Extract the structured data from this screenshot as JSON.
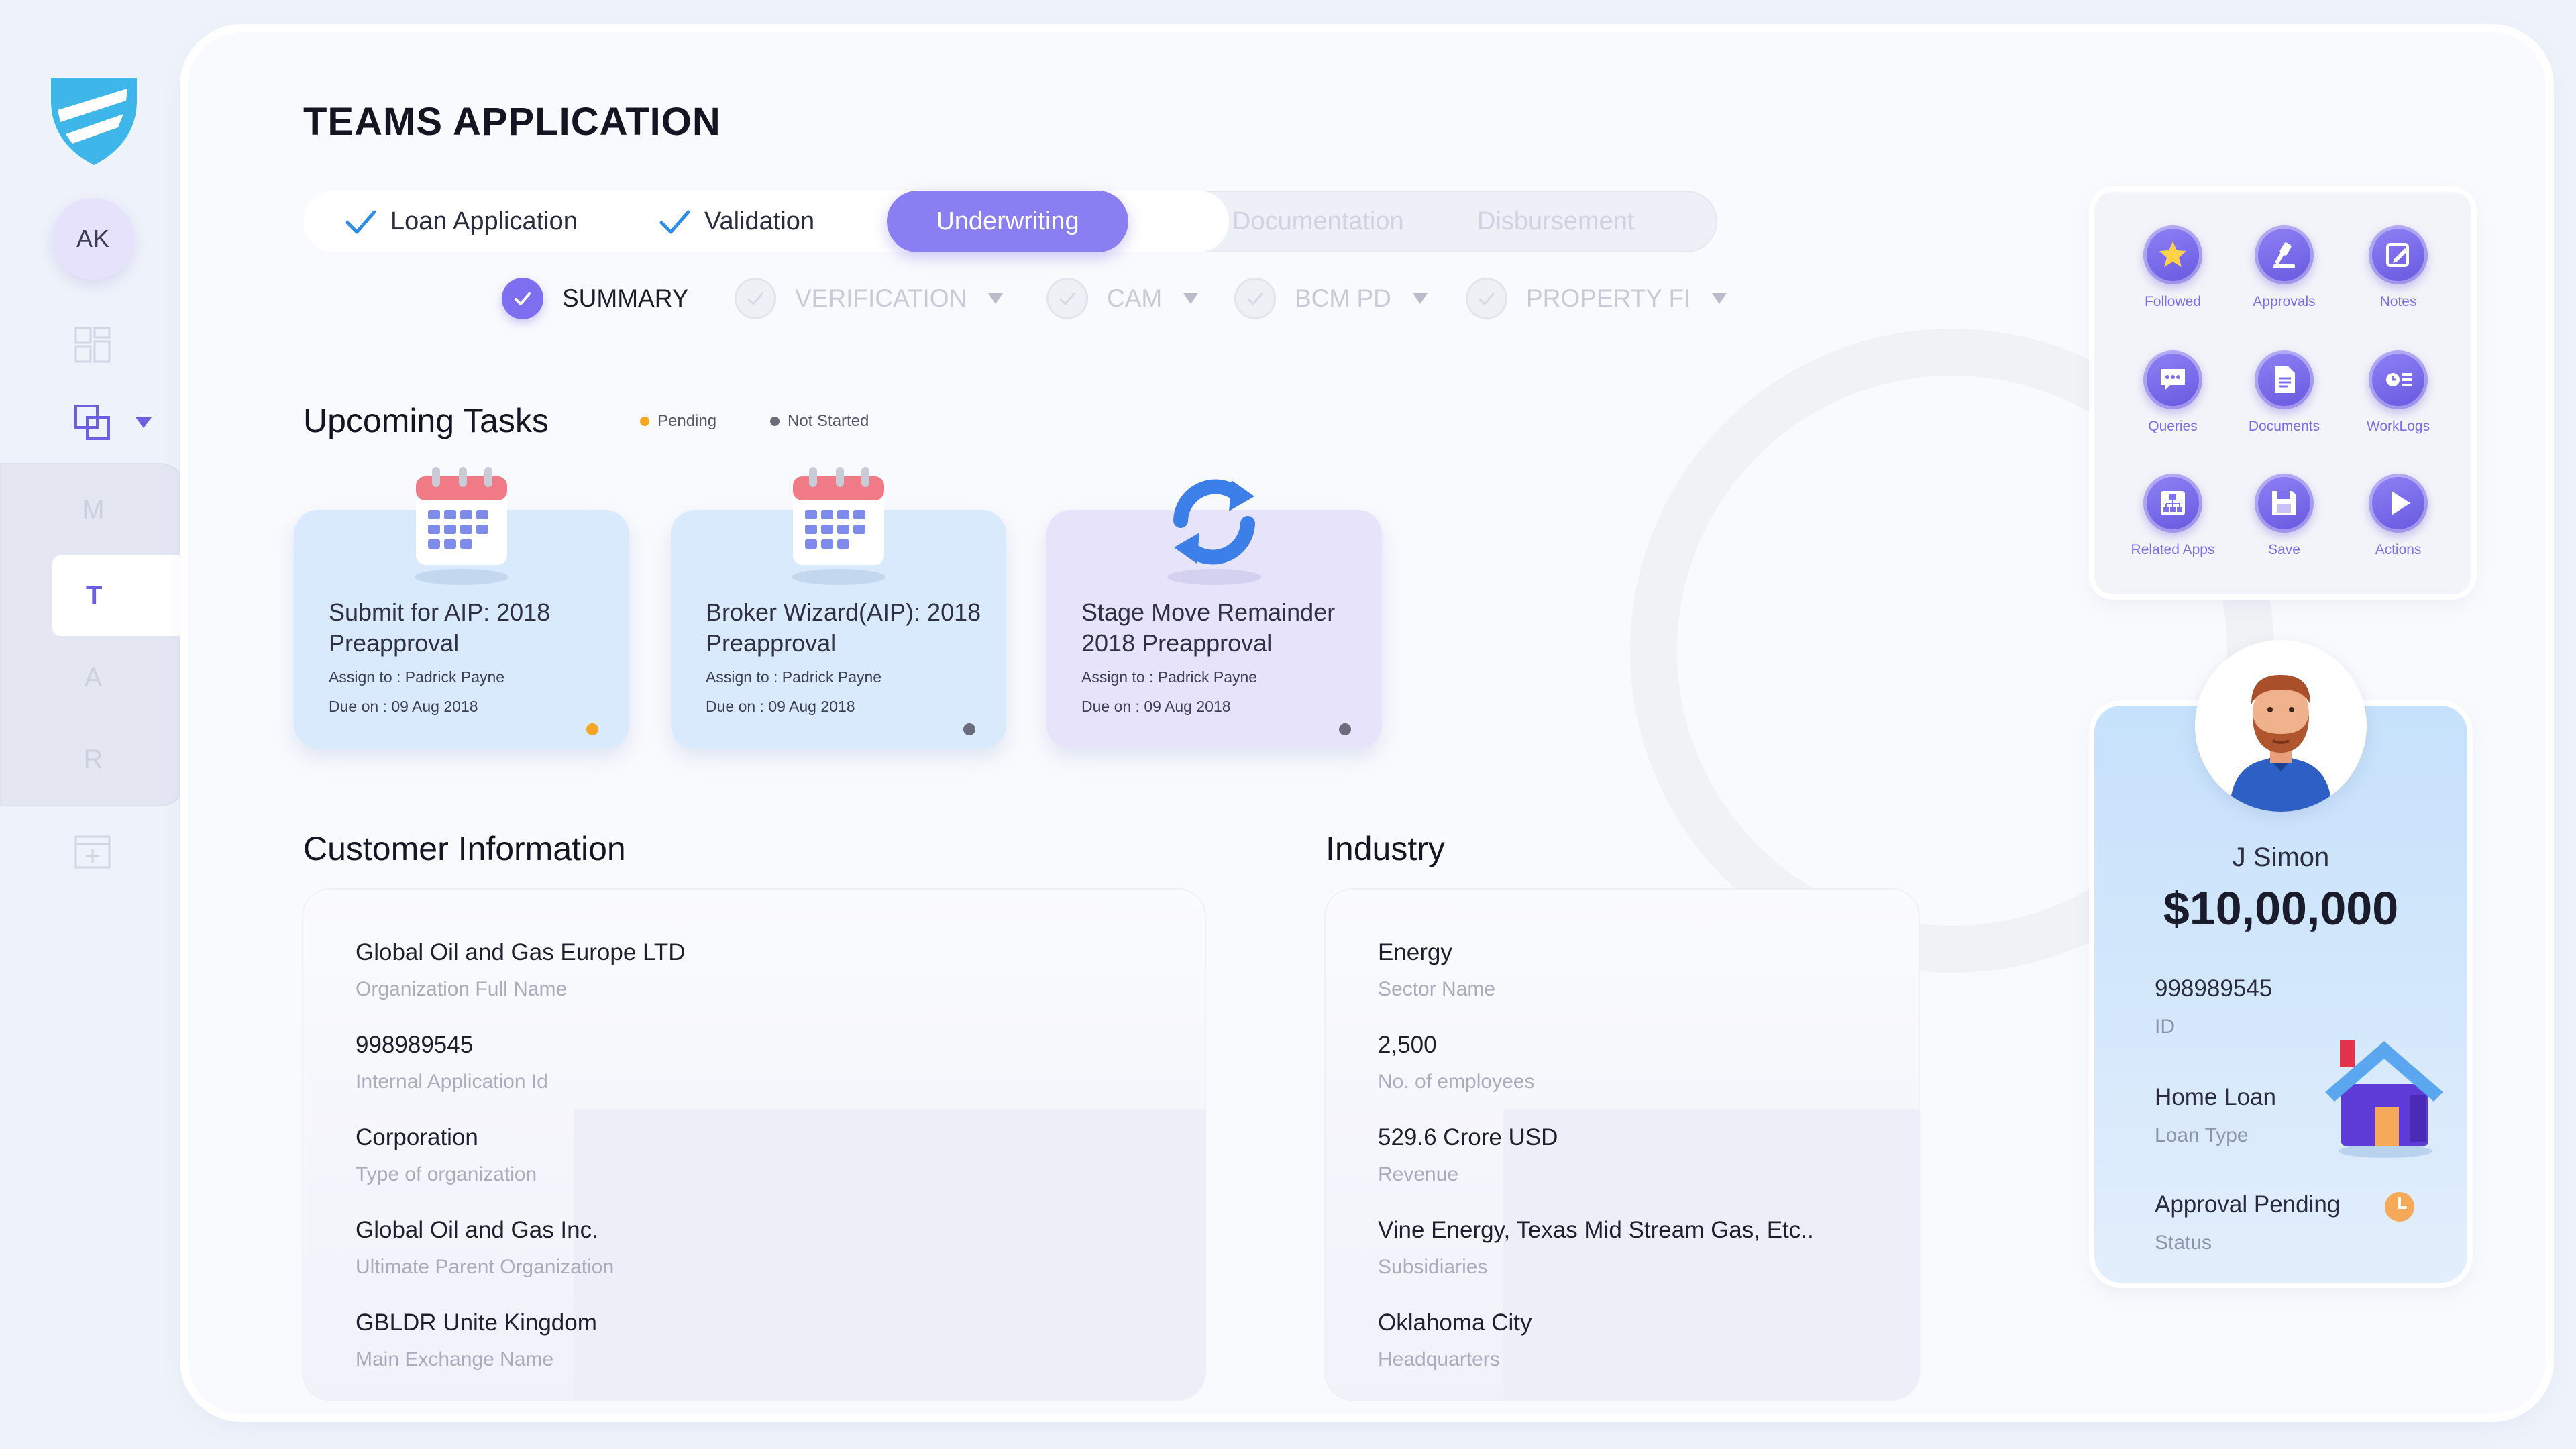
{
  "sidebar": {
    "avatar_initials": "AK",
    "letters": [
      "M",
      "T",
      "A",
      "R"
    ]
  },
  "page": {
    "title": "TEAMS APPLICATION"
  },
  "stepper": {
    "steps": [
      {
        "label": "Loan Application",
        "state": "done"
      },
      {
        "label": "Validation",
        "state": "done"
      },
      {
        "label": "Underwriting",
        "state": "active"
      },
      {
        "label": "Documentation",
        "state": "pending"
      },
      {
        "label": "Disbursement",
        "state": "pending"
      }
    ]
  },
  "substeps": [
    {
      "label": "SUMMARY",
      "active": true
    },
    {
      "label": "VERIFICATION",
      "active": false
    },
    {
      "label": "CAM",
      "active": false
    },
    {
      "label": "BCM PD",
      "active": false
    },
    {
      "label": "PROPERTY FI",
      "active": false
    }
  ],
  "upcoming": {
    "title": "Upcoming Tasks",
    "legend": [
      {
        "label": "Pending",
        "color": "#f6a623"
      },
      {
        "label": "Not Started",
        "color": "#6b6d7c"
      }
    ],
    "tasks": [
      {
        "icon": "calendar-icon",
        "name": "Submit for AIP: 2018 Preapproval",
        "assign": "Assign to : Padrick Payne",
        "due": "Due on : 09 Aug 2018",
        "status_color": "#f6a623"
      },
      {
        "icon": "calendar-icon",
        "name": "Broker Wizard(AIP): 2018 Preapproval",
        "assign": "Assign to : Padrick Payne",
        "due": "Due on : 09 Aug 2018",
        "status_color": "#6b6d7c"
      },
      {
        "icon": "refresh-icon",
        "name": "Stage Move Remainder 2018 Preapproval",
        "assign": "Assign to : Padrick Payne",
        "due": "Due on : 09 Aug 2018",
        "status_color": "#6b6d7c"
      }
    ]
  },
  "customer": {
    "title": "Customer Information",
    "fields": [
      {
        "value": "Global Oil and Gas Europe LTD",
        "label": "Organization Full Name"
      },
      {
        "value": "998989545",
        "label": "Internal Application Id"
      },
      {
        "value": "Corporation",
        "label": "Type of organization"
      },
      {
        "value": "Global Oil and Gas Inc.",
        "label": "Ultimate Parent Organization"
      },
      {
        "value": "GBLDR Unite Kingdom",
        "label": "Main Exchange Name"
      }
    ]
  },
  "industry": {
    "title": "Industry",
    "fields": [
      {
        "value": "Energy",
        "label": "Sector Name"
      },
      {
        "value": "2,500",
        "label": "No. of employees"
      },
      {
        "value": "529.6 Crore USD",
        "label": "Revenue"
      },
      {
        "value": "Vine Energy, Texas Mid Stream Gas, Etc..",
        "label": "Subsidiaries"
      },
      {
        "value": "Oklahoma City",
        "label": "Headquarters"
      }
    ]
  },
  "actions": [
    {
      "label": "Followed",
      "icon": "star-icon"
    },
    {
      "label": "Approvals",
      "icon": "gavel-icon"
    },
    {
      "label": "Notes",
      "icon": "edit-note-icon"
    },
    {
      "label": "Queries",
      "icon": "chat-icon"
    },
    {
      "label": "Documents",
      "icon": "document-icon"
    },
    {
      "label": "WorkLogs",
      "icon": "worklog-icon"
    },
    {
      "label": "Related Apps",
      "icon": "hierarchy-icon"
    },
    {
      "label": "Save",
      "icon": "save-icon"
    },
    {
      "label": "Actions",
      "icon": "play-icon"
    }
  ],
  "profile": {
    "name": "J Simon",
    "amount": "$10,00,000",
    "id_value": "998989545",
    "id_label": "ID",
    "loan_value": "Home Loan",
    "loan_label": "Loan Type",
    "status_value": "Approval Pending",
    "status_label": "Status"
  },
  "colors": {
    "accent": "#8a7ff2",
    "pending": "#f6a623",
    "not_started": "#6b6d7c",
    "logo": "#3fb6e9"
  }
}
